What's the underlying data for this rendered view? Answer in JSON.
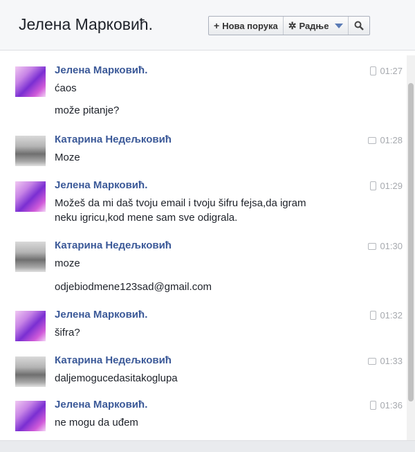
{
  "header": {
    "title": "Јелена Марковић.",
    "new_message_label": "Нова порука",
    "actions_label": "Радње"
  },
  "messages": [
    {
      "sender": "Јелена Марковић.",
      "time": "01:27",
      "device": "phone-icon",
      "lines": [
        "ćaos",
        "može pitanje?"
      ]
    },
    {
      "sender": "Катарина Недељковић",
      "time": "01:28",
      "device": "chat-icon",
      "lines": [
        "Moze"
      ]
    },
    {
      "sender": "Јелена Марковић.",
      "time": "01:29",
      "device": "phone-icon",
      "lines": [
        "Možeš da mi daš tvoju email i tvoju šifru fejsa,da igram",
        "neku igricu,kod mene sam sve odigrala."
      ]
    },
    {
      "sender": "Катарина Недељковић",
      "time": "01:30",
      "device": "chat-icon",
      "lines": [
        "moze",
        "odjebiodmene123sad@gmail.com"
      ]
    },
    {
      "sender": "Јелена Марковић.",
      "time": "01:32",
      "device": "phone-icon",
      "lines": [
        "šifra?"
      ]
    },
    {
      "sender": "Катарина Недељковић",
      "time": "01:33",
      "device": "chat-icon",
      "lines": [
        "daljemogucedasitakoglupa"
      ]
    },
    {
      "sender": "Јелена Марковић.",
      "time": "01:36",
      "device": "phone-icon",
      "lines": [
        "ne mogu da uđem"
      ]
    }
  ]
}
